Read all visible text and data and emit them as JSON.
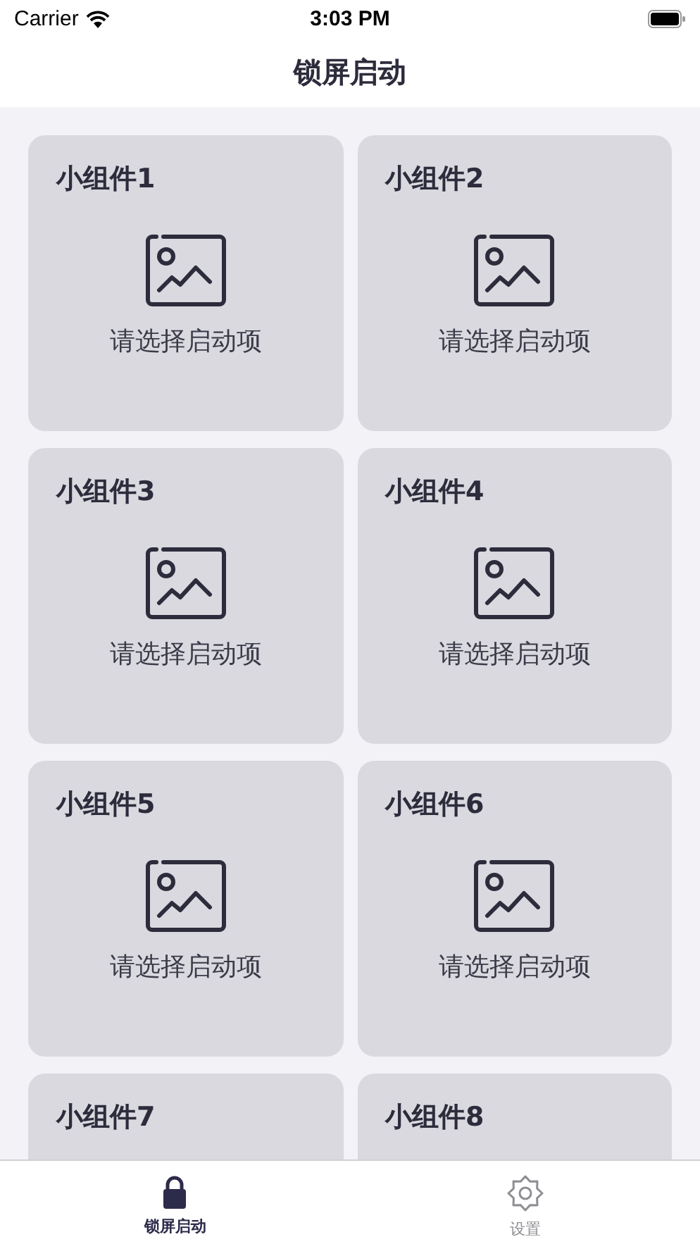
{
  "status_bar": {
    "carrier": "Carrier",
    "time": "3:03 PM"
  },
  "nav": {
    "title": "锁屏启动"
  },
  "cards": [
    {
      "title": "小组件1",
      "hint": "请选择启动项"
    },
    {
      "title": "小组件2",
      "hint": "请选择启动项"
    },
    {
      "title": "小组件3",
      "hint": "请选择启动项"
    },
    {
      "title": "小组件4",
      "hint": "请选择启动项"
    },
    {
      "title": "小组件5",
      "hint": "请选择启动项"
    },
    {
      "title": "小组件6",
      "hint": "请选择启动项"
    },
    {
      "title": "小组件7"
    },
    {
      "title": "小组件8"
    }
  ],
  "tabs": [
    {
      "kind": "lock",
      "label": "锁屏启动",
      "selected": true
    },
    {
      "kind": "settings",
      "label": "设置",
      "selected": false
    }
  ]
}
